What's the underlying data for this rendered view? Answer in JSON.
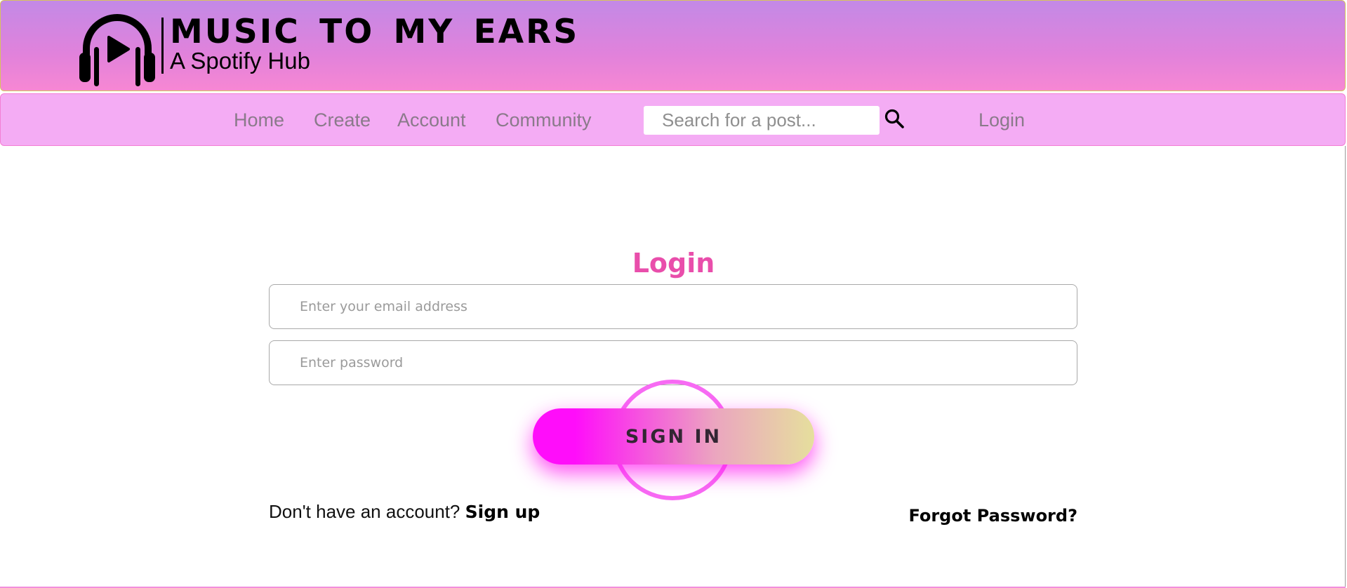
{
  "header": {
    "title": "MUSIC TO MY EARS",
    "subtitle": "A Spotify Hub",
    "logo_icon": "headphones-play-icon"
  },
  "nav": {
    "items": [
      {
        "label": "Home"
      },
      {
        "label": "Create"
      },
      {
        "label": "Account"
      },
      {
        "label": "Community"
      }
    ],
    "search": {
      "placeholder": "Search for a post...",
      "value": "",
      "icon": "search-icon"
    },
    "login_label": "Login"
  },
  "login_form": {
    "title": "Login",
    "email": {
      "placeholder": "Enter your email address",
      "value": ""
    },
    "password": {
      "placeholder": "Enter password",
      "value": ""
    },
    "submit_label": "SIGN IN",
    "signup_prompt": "Don't have an account?",
    "signup_label": "Sign up",
    "forgot_label": "Forgot Password?"
  },
  "colors": {
    "header_gradient_top": "#c389e6",
    "header_gradient_bottom": "#f787d3",
    "nav_background": "#f4acf4",
    "accent_title": "#e94eab",
    "button_gradient_start": "#ff0dfa",
    "button_gradient_end": "#e6df9d",
    "ring": "#f76af3"
  }
}
